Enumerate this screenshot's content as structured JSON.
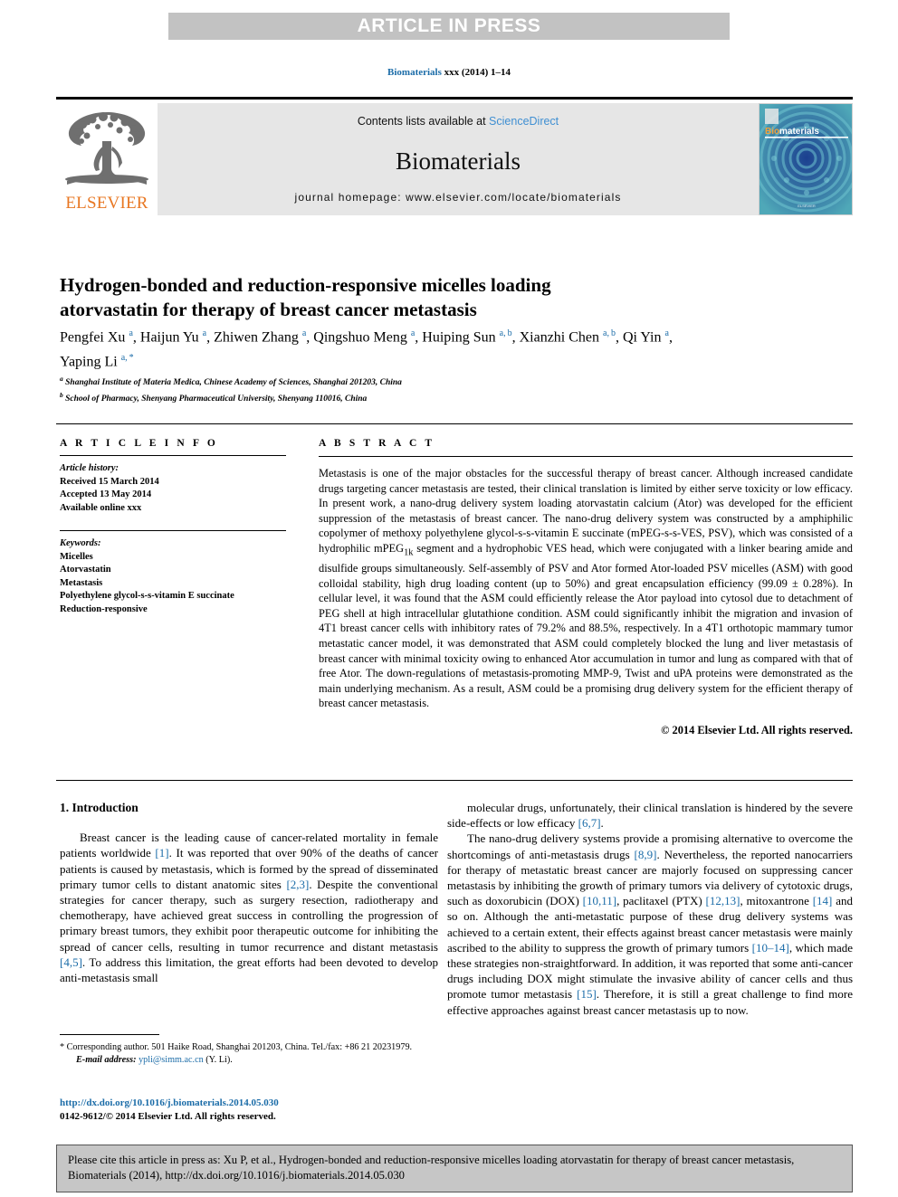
{
  "banner": {
    "text": "ARTICLE IN PRESS"
  },
  "journal_ref": {
    "name": "Biomaterials",
    "rest": " xxx (2014) 1–14"
  },
  "masthead": {
    "contents_prefix": "Contents lists available at ",
    "sciencedirect": "ScienceDirect",
    "journal_title": "Biomaterials",
    "homepage": "journal homepage: www.elsevier.com/locate/biomaterials",
    "publisher_wordmark": "ELSEVIER",
    "cover_title": "Biomaterials"
  },
  "article": {
    "title": "Hydrogen-bonded and reduction-responsive micelles loading atorvastatin for therapy of breast cancer metastasis",
    "authors_html": "Pengfei Xu <sup>a</sup>, Haijun Yu <sup>a</sup>, Zhiwen Zhang <sup>a</sup>, Qingshuo Meng <sup>a</sup>, Huiping Sun <sup>a, b</sup>, Xianzhi Chen <sup>a, b</sup>, Qi Yin <sup>a</sup>, Yaping Li <sup>a, *</sup>",
    "affiliations": [
      {
        "marker": "a",
        "text": "Shanghai Institute of Materia Medica, Chinese Academy of Sciences, Shanghai 201203, China"
      },
      {
        "marker": "b",
        "text": "School of Pharmacy, Shenyang Pharmaceutical University, Shenyang 110016, China"
      }
    ]
  },
  "article_info": {
    "heading": "A R T I C L E   I N F O",
    "history_label": "Article history:",
    "history": [
      "Received 15 March 2014",
      "Accepted 13 May 2014",
      "Available online xxx"
    ],
    "keywords_label": "Keywords:",
    "keywords": [
      "Micelles",
      "Atorvastatin",
      "Metastasis",
      "Polyethylene glycol-s-s-vitamin E succinate",
      "Reduction-responsive"
    ]
  },
  "abstract": {
    "heading": "A B S T R A C T",
    "text": "Metastasis is one of the major obstacles for the successful therapy of breast cancer. Although increased candidate drugs targeting cancer metastasis are tested, their clinical translation is limited by either serve toxicity or low efficacy. In present work, a nano-drug delivery system loading atorvastatin calcium (Ator) was developed for the efficient suppression of the metastasis of breast cancer. The nano-drug delivery system was constructed by a amphiphilic copolymer of methoxy polyethylene glycol-s-s-vitamin E succinate (mPEG-s-s-VES, PSV), which was consisted of a hydrophilic mPEG<sub>1k</sub> segment and a hydrophobic VES head, which were conjugated with a linker bearing amide and disulfide groups simultaneously. Self-assembly of PSV and Ator formed Ator-loaded PSV micelles (ASM) with good colloidal stability, high drug loading content (up to 50%) and great encapsulation efficiency (99.09 ± 0.28%). In cellular level, it was found that the ASM could efficiently release the Ator payload into cytosol due to detachment of PEG shell at high intracellular glutathione condition. ASM could significantly inhibit the migration and invasion of 4T1 breast cancer cells with inhibitory rates of 79.2% and 88.5%, respectively. In a 4T1 orthotopic mammary tumor metastatic cancer model, it was demonstrated that ASM could completely blocked the lung and liver metastasis of breast cancer with minimal toxicity owing to enhanced Ator accumulation in tumor and lung as compared with that of free Ator. The down-regulations of metastasis-promoting MMP-9, Twist and uPA proteins were demonstrated as the main underlying mechanism. As a result, ASM could be a promising drug delivery system for the efficient therapy of breast cancer metastasis.",
    "copyright": "© 2014 Elsevier Ltd. All rights reserved."
  },
  "introduction": {
    "heading": "1. Introduction",
    "left_paragraph": "Breast cancer is the leading cause of cancer-related mortality in female patients worldwide <span class=\"cite\">[1]</span>. It was reported that over 90% of the deaths of cancer patients is caused by metastasis, which is formed by the spread of disseminated primary tumor cells to distant anatomic sites <span class=\"cite\">[2,3]</span>. Despite the conventional strategies for cancer therapy, such as surgery resection, radiotherapy and chemotherapy, have achieved great success in controlling the progression of primary breast tumors, they exhibit poor therapeutic outcome for inhibiting the spread of cancer cells, resulting in tumor recurrence and distant metastasis <span class=\"cite\">[4,5]</span>. To address this limitation, the great efforts had been devoted to develop anti-metastasis small",
    "right_paragraph_1": "molecular drugs, unfortunately, their clinical translation is hindered by the severe side-effects or low efficacy <span class=\"cite\">[6,7]</span>.",
    "right_paragraph_2": "The nano-drug delivery systems provide a promising alternative to overcome the shortcomings of anti-metastasis drugs <span class=\"cite\">[8,9]</span>. Nevertheless, the reported nanocarriers for therapy of metastatic breast cancer are majorly focused on suppressing cancer metastasis by inhibiting the growth of primary tumors via delivery of cytotoxic drugs, such as doxorubicin (DOX) <span class=\"cite\">[10,11]</span>, paclitaxel (PTX) <span class=\"cite\">[12,13]</span>, mitoxantrone <span class=\"cite\">[14]</span> and so on. Although the anti-metastatic purpose of these drug delivery systems was achieved to a certain extent, their effects against breast cancer metastasis were mainly ascribed to the ability to suppress the growth of primary tumors <span class=\"cite\">[10–14]</span>, which made these strategies non-straightforward. In addition, it was reported that some anti-cancer drugs including DOX might stimulate the invasive ability of cancer cells and thus promote tumor metastasis <span class=\"cite\">[15]</span>. Therefore, it is still a great challenge to find more effective approaches against breast cancer metastasis up to now."
  },
  "footnote": {
    "corresponding": "* Corresponding author. 501 Haike Road, Shanghai 201203, China. Tel./fax: +86 21 20231979.",
    "email_label": "E-mail address:",
    "email": "ypli@simm.ac.cn",
    "email_suffix": " (Y. Li)."
  },
  "doi_line": {
    "doi": "http://dx.doi.org/10.1016/j.biomaterials.2014.05.030",
    "issn": "0142-9612/© 2014 Elsevier Ltd. All rights reserved."
  },
  "citation_box": {
    "text": "Please cite this article in press as: Xu P, et al., Hydrogen-bonded and reduction-responsive micelles loading atorvastatin for therapy of breast cancer metastasis, Biomaterials (2014), http://dx.doi.org/10.1016/j.biomaterials.2014.05.030"
  },
  "colors": {
    "banner_bg": "#c2c2c2",
    "link_blue": "#1b6ca8",
    "sciencedirect_blue": "#3f8fd2",
    "elsevier_orange": "#e87722",
    "masthead_gray": "#e6e6e6",
    "citebox_gray": "#c6c6c6"
  }
}
